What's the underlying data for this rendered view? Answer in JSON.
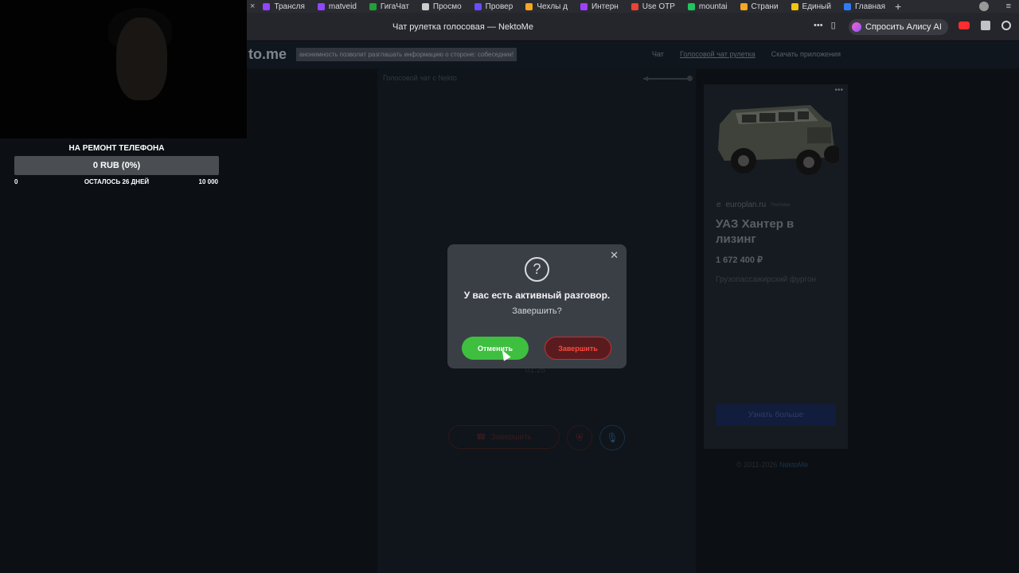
{
  "browser": {
    "tabs": [
      {
        "label": "Трансля",
        "color": "#9146ff"
      },
      {
        "label": "matveid",
        "color": "#9146ff"
      },
      {
        "label": "ГигаЧат",
        "color": "#21a038"
      },
      {
        "label": "Просмо",
        "color": "#cccccc"
      },
      {
        "label": "Провер",
        "color": "#6b4cff"
      },
      {
        "label": "Чехлы д",
        "color": "#f5a623"
      },
      {
        "label": "Интерн",
        "color": "#a040ff"
      },
      {
        "label": "Use OTP",
        "color": "#ea4335"
      },
      {
        "label": "mountai",
        "color": "#21c55d"
      },
      {
        "label": "Страни",
        "color": "#f5a623"
      },
      {
        "label": "Единый",
        "color": "#f1c40f"
      },
      {
        "label": "Главная",
        "color": "#2d7cf6"
      }
    ],
    "page_title": "Чат рулетка голосовая — NektoMe",
    "alice_label": "Спросить Алису AI"
  },
  "site": {
    "logo": "to.me",
    "notice": "анонимность позволит разглашать информацию о стороне: собеседник!",
    "nav": [
      "Чат",
      "Голосовой чат рулетка",
      "Скачать приложения"
    ],
    "chat_header": "Голосовой чат с Nekto",
    "timer": "01:25",
    "end_button": "Завершить",
    "copyright_prefix": "© 2011-2026",
    "copyright_brand": "NektoMe"
  },
  "ad": {
    "domain": "europlan.ru",
    "domain_tag": "Реклама",
    "title": "УАЗ Хантер в лизинг",
    "price": "1 672 400 ₽",
    "description": "Грузопассажирский фургон",
    "button": "Узнать больше"
  },
  "modal": {
    "title": "У вас есть активный разговор.",
    "subtitle": "Завершить?",
    "cancel": "Отменить",
    "confirm": "Завершить"
  },
  "stream": {
    "fund_title": "НА РЕМОНТ ТЕЛЕФОНА",
    "fund_amount": "0 RUB (0%)",
    "fund_progress": 0,
    "fund_min": "0",
    "fund_remaining": "ОСТАЛОСЬ 26 ДНЕЙ",
    "fund_max": "10 000"
  }
}
